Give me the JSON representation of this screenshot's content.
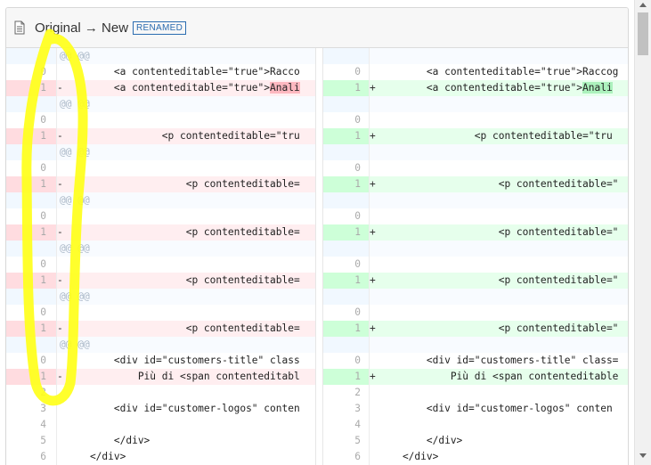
{
  "header": {
    "file_icon": "file-icon",
    "title": "Original → New",
    "badge": "RENAMED"
  },
  "rows": [
    {
      "type": "hunk",
      "text": "@@ @@"
    },
    {
      "type": "ctx",
      "ln": "0",
      "rn": "0",
      "code_l": "        <a contenteditable=\"true\">Racco",
      "code_r": "        <a contenteditable=\"true\">Raccog"
    },
    {
      "type": "change",
      "ln": "1",
      "rn": "1",
      "pre_l": "        <a contenteditable=\"true\">",
      "hl_l": "Anali",
      "pre_r": "        <a contenteditable=\"true\">",
      "hl_r": "Anali"
    },
    {
      "type": "hunk",
      "text": "@@ @@"
    },
    {
      "type": "ctx",
      "ln": "0",
      "rn": "0",
      "code_l": "",
      "code_r": ""
    },
    {
      "type": "change",
      "ln": "1",
      "rn": "1",
      "pre_l": "                <p contenteditable=\"tru",
      "hl_l": "",
      "pre_r": "                <p contenteditable=\"tru",
      "hl_r": ""
    },
    {
      "type": "hunk",
      "text": "@@ @@"
    },
    {
      "type": "ctx",
      "ln": "0",
      "rn": "0",
      "code_l": "",
      "code_r": ""
    },
    {
      "type": "change",
      "ln": "1",
      "rn": "1",
      "pre_l": "                    <p contenteditable=",
      "hl_l": "",
      "pre_r": "                    <p contenteditable=\"",
      "hl_r": ""
    },
    {
      "type": "hunk",
      "text": "@@ @@"
    },
    {
      "type": "ctx",
      "ln": "0",
      "rn": "0",
      "code_l": "",
      "code_r": ""
    },
    {
      "type": "change",
      "ln": "1",
      "rn": "1",
      "pre_l": "                    <p contenteditable=",
      "hl_l": "",
      "pre_r": "                    <p contenteditable=\"",
      "hl_r": ""
    },
    {
      "type": "hunk",
      "text": "@@ @@"
    },
    {
      "type": "ctx",
      "ln": "0",
      "rn": "0",
      "code_l": "",
      "code_r": ""
    },
    {
      "type": "change",
      "ln": "1",
      "rn": "1",
      "pre_l": "                    <p contenteditable=",
      "hl_l": "",
      "pre_r": "                    <p contenteditable=\"",
      "hl_r": ""
    },
    {
      "type": "hunk",
      "text": "@@ @@"
    },
    {
      "type": "ctx",
      "ln": "0",
      "rn": "0",
      "code_l": "",
      "code_r": ""
    },
    {
      "type": "change",
      "ln": "1",
      "rn": "1",
      "pre_l": "                    <p contenteditable=",
      "hl_l": "",
      "pre_r": "                    <p contenteditable=\"",
      "hl_r": ""
    },
    {
      "type": "hunk",
      "text": "@@ @@"
    },
    {
      "type": "ctx",
      "ln": "0",
      "rn": "0",
      "code_l": "        <div id=\"customers-title\" class",
      "code_r": "        <div id=\"customers-title\" class="
    },
    {
      "type": "change",
      "ln": "1",
      "rn": "1",
      "pre_l": "            Più di <span contenteditabl",
      "hl_l": "",
      "pre_r": "            Più di <span contenteditable",
      "hl_r": ""
    },
    {
      "type": "ctx",
      "ln": "2",
      "rn": "2",
      "code_l": "",
      "code_r": ""
    },
    {
      "type": "ctx",
      "ln": "3",
      "rn": "3",
      "code_l": "        <div id=\"customer-logos\" conten",
      "code_r": "        <div id=\"customer-logos\" conten"
    },
    {
      "type": "ctx",
      "ln": "4",
      "rn": "4",
      "code_l": "",
      "code_r": ""
    },
    {
      "type": "ctx",
      "ln": "5",
      "rn": "5",
      "code_l": "        </div>",
      "code_r": "        </div>"
    },
    {
      "type": "ctx",
      "ln": "6",
      "rn": "6",
      "code_l": "    </div>",
      "code_r": "    </div>"
    }
  ],
  "signs": {
    "del": "-",
    "add": "+"
  },
  "colors": {
    "annotation": "#ffff1a",
    "badge": "#2b6cb0"
  }
}
